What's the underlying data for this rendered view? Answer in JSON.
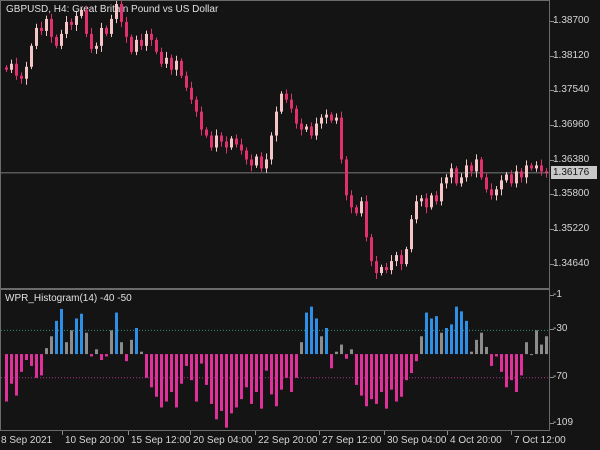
{
  "main_chart": {
    "title": "GBPUSD, H4:  Great Britain Pound vs US Dollar",
    "price_labels": [
      "1.38700",
      "1.38120",
      "1.37540",
      "1.36960",
      "1.36380",
      "1.35800",
      "1.35220",
      "1.34640"
    ],
    "current_price": "1.36176",
    "colors": {
      "bull": "#f4c6c6",
      "bear": "#e0306e",
      "background": "#141414",
      "grid": "#6b6b6b",
      "current_line": "#9a9a9a"
    }
  },
  "indicator": {
    "title": "WPR_Histogram(14) -40 -50",
    "scale_labels": [
      "-1",
      "-30",
      "-70",
      "-109"
    ],
    "colors": {
      "up": "#2f8fe6",
      "neutral": "#8c8c8c",
      "down": "#e0309a",
      "level_up": "#2f8f7a",
      "level_down": "#b0308f"
    }
  },
  "time_axis": {
    "labels": [
      "8 Sep 2021",
      "10 Sep 20:00",
      "15 Sep 12:00",
      "20 Sep 04:00",
      "22 Sep 20:00",
      "27 Sep 12:00",
      "30 Sep 04:00",
      "4 Oct 20:00",
      "7 Oct 12:00"
    ]
  },
  "chart_data": [
    {
      "type": "candlestick",
      "title": "GBPUSD, H4:  Great Britain Pound vs US Dollar",
      "y_ticks": [
        1.387,
        1.3812,
        1.3754,
        1.3696,
        1.3638,
        1.358,
        1.3522,
        1.3464
      ],
      "ylim": [
        1.3425,
        1.3905
      ],
      "current_price": 1.36176,
      "x_tick_labels": [
        "8 Sep 2021",
        "10 Sep 20:00",
        "15 Sep 12:00",
        "20 Sep 04:00",
        "22 Sep 20:00",
        "27 Sep 12:00",
        "30 Sep 04:00",
        "4 Oct 20:00",
        "7 Oct 12:00"
      ],
      "close": [
        1.379,
        1.38,
        1.378,
        1.3775,
        1.3795,
        1.383,
        1.386,
        1.3855,
        1.3875,
        1.3845,
        1.383,
        1.385,
        1.387,
        1.3865,
        1.388,
        1.389,
        1.385,
        1.3825,
        1.383,
        1.386,
        1.385,
        1.3875,
        1.39,
        1.387,
        1.3845,
        1.382,
        1.384,
        1.383,
        1.385,
        1.384,
        1.382,
        1.38,
        1.381,
        1.379,
        1.3805,
        1.378,
        1.376,
        1.374,
        1.372,
        1.369,
        1.368,
        1.366,
        1.368,
        1.367,
        1.366,
        1.3675,
        1.3665,
        1.3655,
        1.364,
        1.363,
        1.3645,
        1.3625,
        1.364,
        1.368,
        1.372,
        1.375,
        1.374,
        1.3725,
        1.37,
        1.369,
        1.3695,
        1.368,
        1.37,
        1.371,
        1.3715,
        1.3705,
        1.371,
        1.364,
        1.358,
        1.356,
        1.355,
        1.357,
        1.351,
        1.347,
        1.345,
        1.346,
        1.3455,
        1.347,
        1.348,
        1.3465,
        1.349,
        1.354,
        1.357,
        1.3575,
        1.356,
        1.358,
        1.357,
        1.36,
        1.361,
        1.3625,
        1.36,
        1.361,
        1.363,
        1.362,
        1.364,
        1.361,
        1.359,
        1.358,
        1.359,
        1.3605,
        1.3615,
        1.36,
        1.362,
        1.361,
        1.363,
        1.3625,
        1.363,
        1.362,
        1.3618
      ],
      "colors": {
        "bull": "#f4c6c6",
        "bear": "#e0306e"
      }
    },
    {
      "type": "bar",
      "title": "WPR_Histogram(14) -40 -50",
      "y_ticks": [
        -1,
        -30,
        -70,
        -109
      ],
      "ylim": [
        -114,
        4
      ],
      "levels": [
        -40,
        -50
      ],
      "values": [
        -90,
        -75,
        -85,
        -65,
        -55,
        -60,
        -70,
        -68,
        -45,
        -35,
        -22,
        -12,
        -40,
        -30,
        -20,
        -16,
        -32,
        -52,
        -46,
        -55,
        -52,
        -30,
        -15,
        -40,
        -56,
        -38,
        -28,
        -48,
        -70,
        -78,
        -86,
        -95,
        -90,
        -82,
        -95,
        -75,
        -60,
        -72,
        -90,
        -58,
        -76,
        -92,
        -105,
        -98,
        -112,
        -100,
        -95,
        -88,
        -78,
        -92,
        -82,
        -96,
        -64,
        -84,
        -94,
        -80,
        -70,
        -82,
        -70,
        -40,
        -15,
        -10,
        -20,
        -35,
        -28,
        -62,
        -48,
        -42,
        -54,
        -46,
        -76,
        -85,
        -94,
        -88,
        -92,
        -82,
        -96,
        -80,
        -90,
        -86,
        -72,
        -66,
        -56,
        -35,
        -15,
        -20,
        -18,
        -32,
        -28,
        -25,
        -10,
        -14,
        -22,
        -48,
        -38,
        -32,
        -44,
        -60,
        -52,
        -65,
        -78,
        -72,
        -82,
        -68,
        -40,
        -50,
        -30,
        -42,
        -35,
        -45,
        -20,
        -40,
        -42
      ]
    }
  ]
}
